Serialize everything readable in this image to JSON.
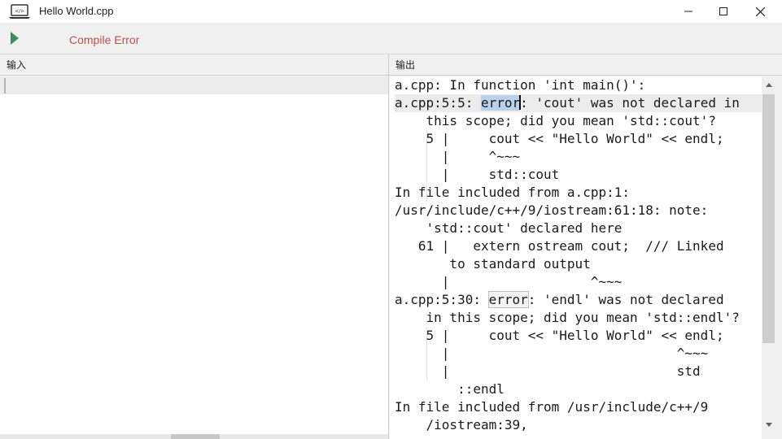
{
  "window": {
    "title": "Hello World.cpp",
    "icon": "laptop-code-icon",
    "controls": [
      "minimize-icon",
      "maximize-icon",
      "close-icon"
    ]
  },
  "toolbar": {
    "run_icon": "play-icon",
    "status": "Compile Error",
    "status_color": "#c0504d",
    "run_color": "#3a8f5a"
  },
  "panels": {
    "input_label": "输入",
    "output_label": "输出"
  },
  "output": {
    "lines": [
      "a.cpp: In function 'int main()':",
      "a.cpp:5:5: error: 'cout' was not declared in",
      "    this scope; did you mean 'std::cout'?",
      "    5 |     cout << \"Hello World\" << endl;",
      "      |     ^~~~",
      "      |     std::cout",
      "In file included from a.cpp:1:",
      "/usr/include/c++/9/iostream:61:18: note:",
      "    'std::cout' declared here",
      "   61 |   extern ostream cout;  /// Linked",
      "       to standard output",
      "      |                  ^~~~",
      "a.cpp:5:30: error: 'endl' was not declared",
      "    in this scope; did you mean 'std::endl'?",
      "    5 |     cout << \"Hello World\" << endl;",
      "      |                             ^~~~",
      "      |                             std",
      "        ::endl",
      "In file included from /usr/include/c++/9",
      "    /iostream:39,"
    ]
  }
}
